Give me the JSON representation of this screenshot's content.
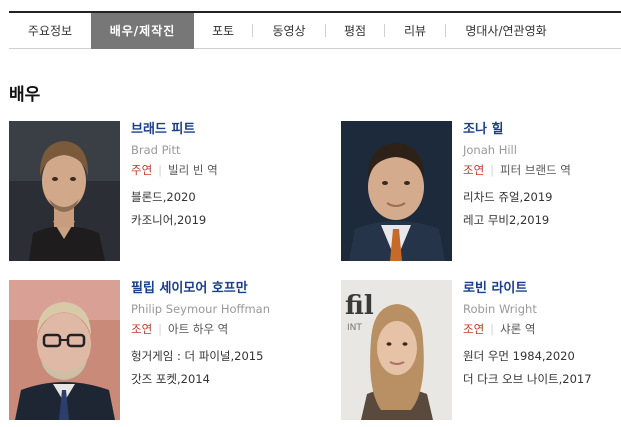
{
  "tabs": [
    {
      "label": "주요정보",
      "active": false
    },
    {
      "label": "배우/제작진",
      "active": true
    },
    {
      "label": "포토",
      "active": false
    },
    {
      "label": "동영상",
      "active": false
    },
    {
      "label": "평점",
      "active": false
    },
    {
      "label": "리뷰",
      "active": false
    },
    {
      "label": "명대사/연관영화",
      "active": false
    }
  ],
  "section_title": "배우",
  "actors": [
    {
      "name": "브래드 피트",
      "name_en": "Brad Pitt",
      "role_type": "주연",
      "role_name": "빌리 빈 역",
      "films": [
        "블론드,2020",
        "카조니어,2019"
      ]
    },
    {
      "name": "조나 힐",
      "name_en": "Jonah Hill",
      "role_type": "조연",
      "role_name": "피터 브랜드 역",
      "films": [
        "리차드 쥬얼,2019",
        "레고 무비2,2019"
      ]
    },
    {
      "name": "필립 세이모어 호프만",
      "name_en": "Philip Seymour Hoffman",
      "role_type": "조연",
      "role_name": "아트 하우 역",
      "films": [
        "헝거게임 : 더 파이널,2015",
        "갓즈 포켓,2014"
      ]
    },
    {
      "name": "로빈 라이트",
      "name_en": "Robin Wright",
      "role_type": "조연",
      "role_name": "샤론 역",
      "films": [
        "원더 우먼 1984,2020",
        "더 다크 오브 나이트,2017"
      ]
    }
  ],
  "photo_text": {
    "bg_a": "fil",
    "bg_b": "INT"
  },
  "colors": {
    "accent": "#1a3e8c",
    "role": "#c0392b",
    "active_tab": "#777777"
  }
}
